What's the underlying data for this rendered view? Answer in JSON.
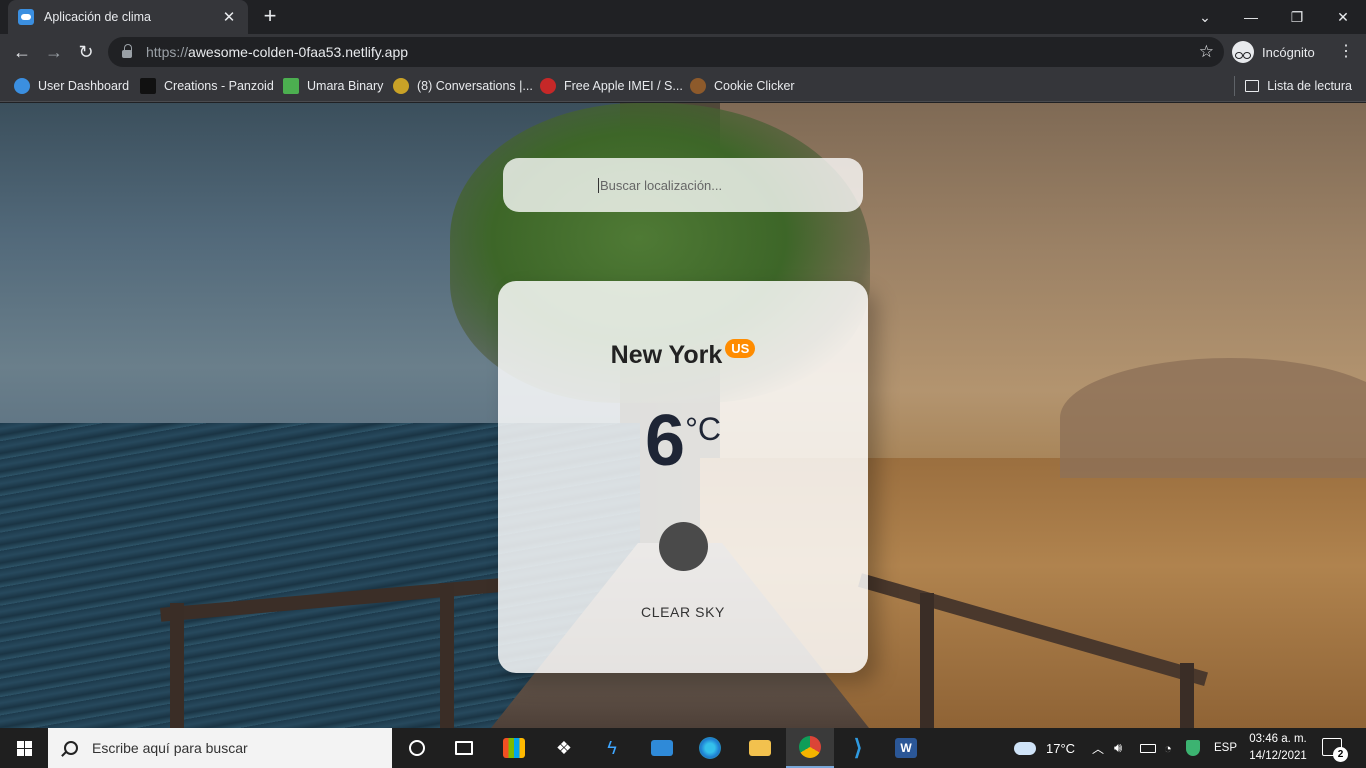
{
  "browser": {
    "tab_title": "Aplicación de clima",
    "url_scheme": "https://",
    "url_host": "awesome-colden-0faa53.netlify.app",
    "incognito_label": "Incógnito",
    "bookmarks": [
      {
        "label": "User Dashboard",
        "color": "#3b8fe0"
      },
      {
        "label": "Creations - Panzoid",
        "color": "#111111"
      },
      {
        "label": "Umara Binary",
        "color": "#4caf50"
      },
      {
        "label": "(8) Conversations |...",
        "color": "#c9a227"
      },
      {
        "label": "Free Apple IMEI / S...",
        "color": "#c62828"
      },
      {
        "label": "Cookie Clicker",
        "color": "#8d5a2b"
      }
    ],
    "reading_list_label": "Lista de lectura"
  },
  "app": {
    "search_placeholder": "Buscar localización...",
    "city": "New York",
    "country": "US",
    "temperature": "6",
    "unit": "°C",
    "description": "CLEAR SKY"
  },
  "taskbar": {
    "search_placeholder": "Escribe aquí para buscar",
    "weather_temp": "17°C",
    "language": "ESP",
    "time": "03:46 a. m.",
    "date": "14/12/2021",
    "notification_count": "2"
  }
}
